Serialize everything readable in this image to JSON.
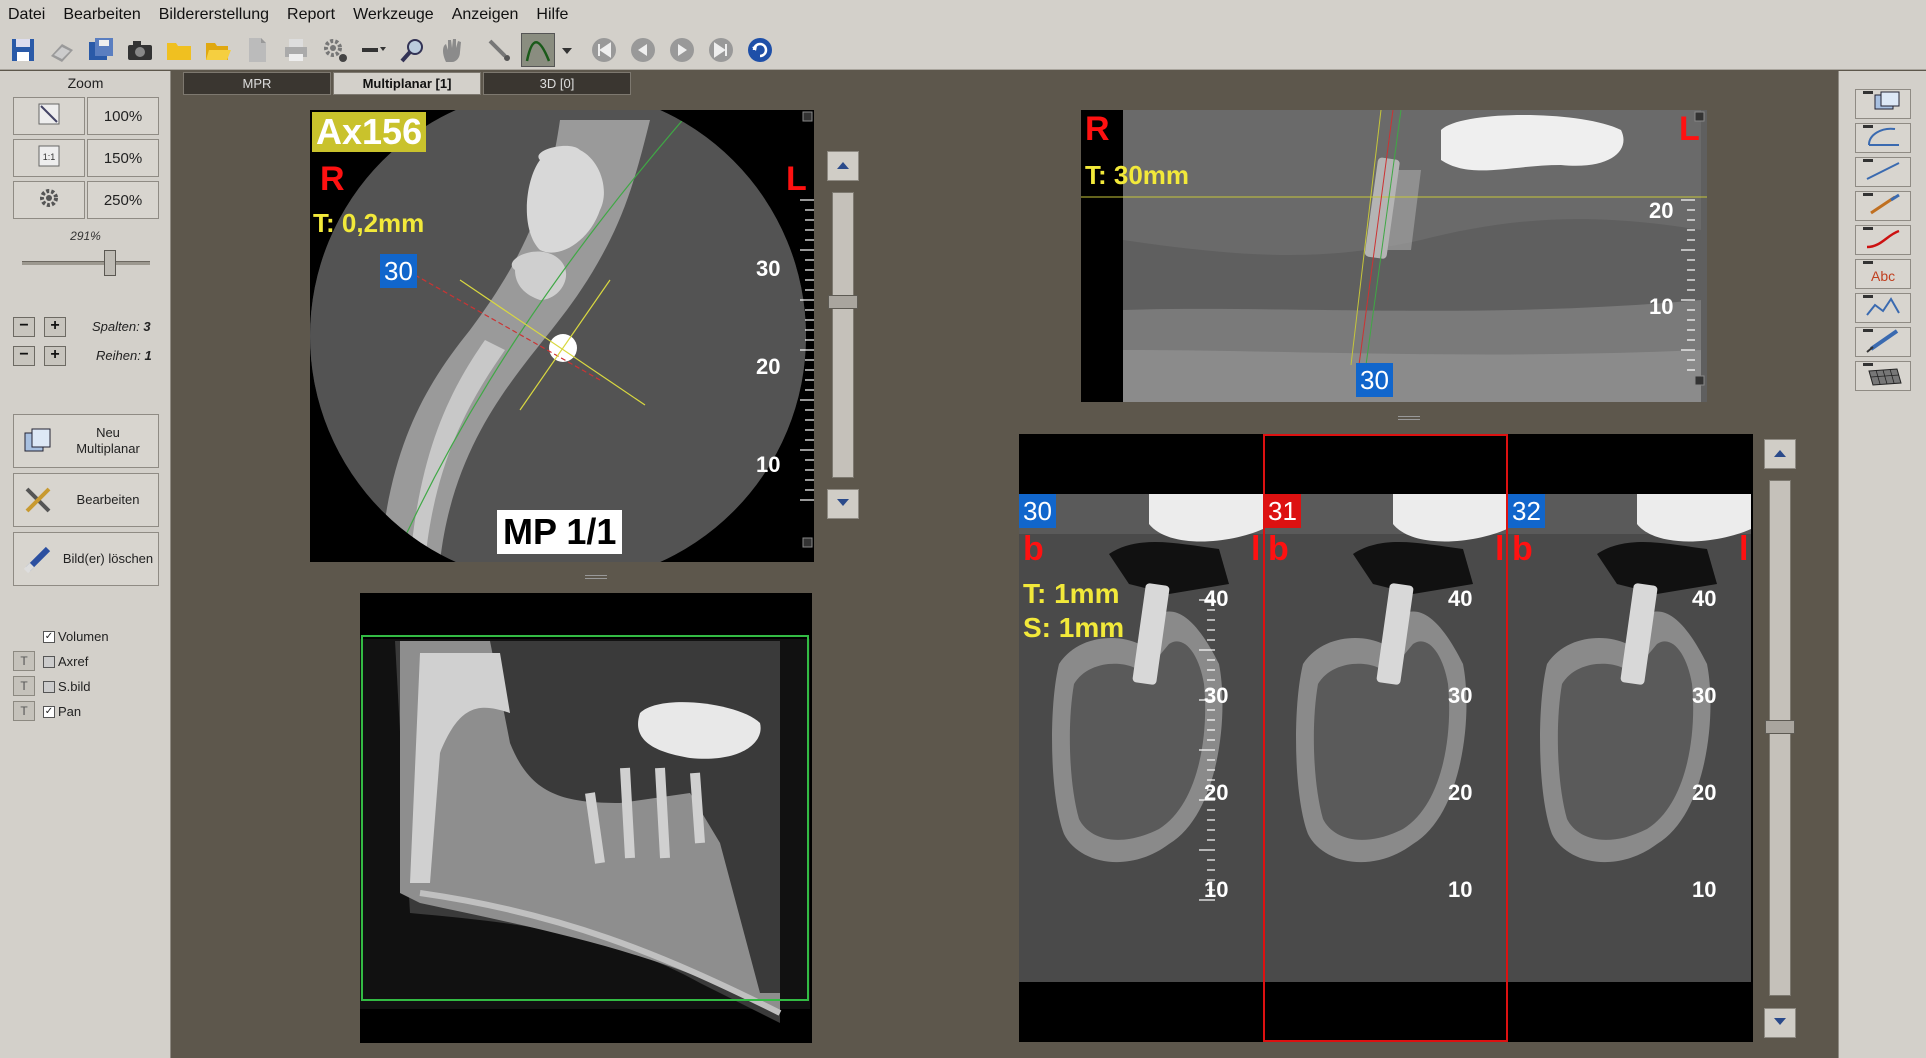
{
  "menu": [
    "Datei",
    "Bearbeiten",
    "Bildererstellung",
    "Report",
    "Werkzeuge",
    "Anzeigen",
    "Hilfe"
  ],
  "toolbar_icons": [
    "save-icon",
    "open-scan-icon",
    "save-copy-icon",
    "camera-icon",
    "folder-icon",
    "open-folder-icon",
    "document-icon",
    "print-icon",
    "settings-gear-icon",
    "dash-dropdown-icon",
    "magnifier-icon",
    "hand-icon",
    "brush-icon",
    "curve-icon",
    "first-frame-icon",
    "previous-frame-icon",
    "play-icon",
    "last-frame-icon",
    "refresh-icon"
  ],
  "zoom": {
    "title": "Zoom",
    "btn_100": "100%",
    "btn_150": "150%",
    "btn_250": "250%",
    "current": "291%",
    "slider_level": 0.67
  },
  "grid": {
    "columns_label": "Spalten:",
    "columns": "3",
    "rows_label": "Reihen:",
    "rows": "1"
  },
  "actions": {
    "new_mp_line1": "Neu",
    "new_mp_line2": "Multiplanar",
    "edit": "Bearbeiten",
    "delete": "Bild(er) löschen"
  },
  "checks": [
    {
      "label": "Volumen",
      "checked": true
    },
    {
      "label": "Axref",
      "checked": false
    },
    {
      "label": "S.bild",
      "checked": false
    },
    {
      "label": "Pan",
      "checked": true
    }
  ],
  "tbtn_label": "T",
  "tabs": [
    {
      "label": "MPR",
      "active": false
    },
    {
      "label": "Multiplanar [1]",
      "active": true
    },
    {
      "label": "3D [0]",
      "active": false
    }
  ],
  "axial": {
    "title": "Ax156",
    "right_marker": "R",
    "left_marker": "L",
    "thickness": "T: 0,2mm",
    "slice_badge": "30",
    "caption": "MP 1/1",
    "ruler": [
      "30",
      "20",
      "10"
    ]
  },
  "pano_top": {
    "right_marker": "R",
    "left_marker": "L",
    "thickness": "T: 30mm",
    "badge": "30",
    "ruler": [
      "20",
      "10"
    ]
  },
  "cross": {
    "thickness": "T: 1mm",
    "spacing": "S: 1mm",
    "b_marker": "b",
    "l_marker": "l",
    "slices": [
      {
        "badge": "30",
        "selected": false
      },
      {
        "badge": "31",
        "selected": true
      },
      {
        "badge": "32",
        "selected": false
      }
    ],
    "ruler": [
      "40",
      "30",
      "20",
      "10"
    ]
  },
  "colors": {
    "annotation_yellow": "#f2e93a",
    "marker_red": "#ff1111",
    "badge_blue": "#1166cc",
    "selection_red": "#dd1111",
    "roi_green": "#33bb44"
  },
  "right_tools": [
    "new-multiplanar-icon",
    "angle-icon",
    "line-measure-icon",
    "pen-icon",
    "red-curve-icon",
    "text-annotation-icon",
    "profile-icon",
    "syringe-icon",
    "grid-icon"
  ]
}
